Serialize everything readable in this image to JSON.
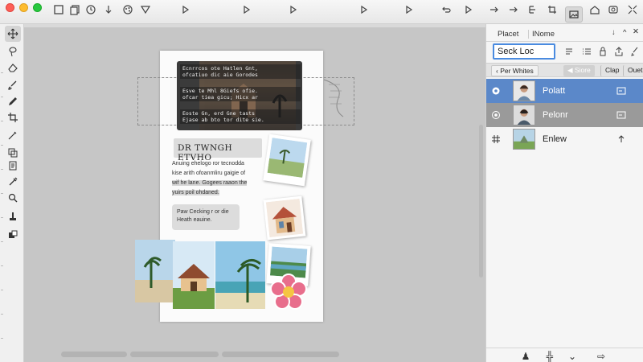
{
  "toolbar": {
    "icons": [
      "new-document-icon",
      "copy-icon",
      "history-icon",
      "palette-icon",
      "send-icon",
      "play-icon",
      "play-icon",
      "play-icon",
      "play-icon",
      "undo-icon",
      "play-icon",
      "forward-icon",
      "image-icon",
      "home-icon",
      "stamp-icon",
      "expand-icon"
    ],
    "accent": "#4a8be0"
  },
  "document": {
    "banner_lines": [
      "Ecnrrcos ote Hatlen Gnt,",
      "ofcatiuo dic aie Gorodes",
      "Esve te Mhl 8Giefs ofie.",
      "ofcar tiea gicu; Hicx ar",
      "Eoste Gn, erd Gne tasts",
      "Ejase ab bto tor dite sie."
    ],
    "heading": "DR TWNGH ETVHO",
    "para_lines": [
      "Anuing ehelogo ror tecnodda",
      "kise arith ofoanmliru gaigie of",
      "wif he lane. Gogees raaon the",
      "yuirs poil ohdaned."
    ],
    "para2_lines": [
      "Paw Cecking r or die",
      "Heath eauine."
    ]
  },
  "panel": {
    "tabs": [
      "Placet",
      "INome"
    ],
    "search_value": "Seck Loc",
    "filters": [
      "Per Whites",
      "Siore",
      "Clap",
      "Ouet"
    ],
    "layers": [
      {
        "name": "Polatt",
        "selected": true
      },
      {
        "name": "Pelonr",
        "selected": false
      },
      {
        "name": "Enlew",
        "selected": false
      }
    ],
    "colors": {
      "selected_row": "#5b88c9",
      "second_row": "#9a9a9a"
    }
  }
}
